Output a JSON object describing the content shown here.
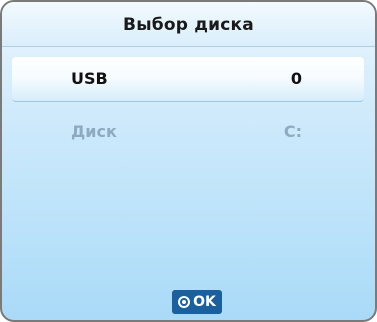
{
  "dialog": {
    "title": "Выбор диска"
  },
  "drives": [
    {
      "label": "USB",
      "value": "0",
      "state": "selected"
    },
    {
      "label": "Диск",
      "value": "C:",
      "state": "disabled"
    }
  ],
  "footer": {
    "ok_icon": "ok-circle-icon",
    "ok_label": "OK"
  },
  "colors": {
    "background": "#b8e1fa",
    "ok_button": "#1a5f9e",
    "disabled_text": "#8faac0"
  }
}
